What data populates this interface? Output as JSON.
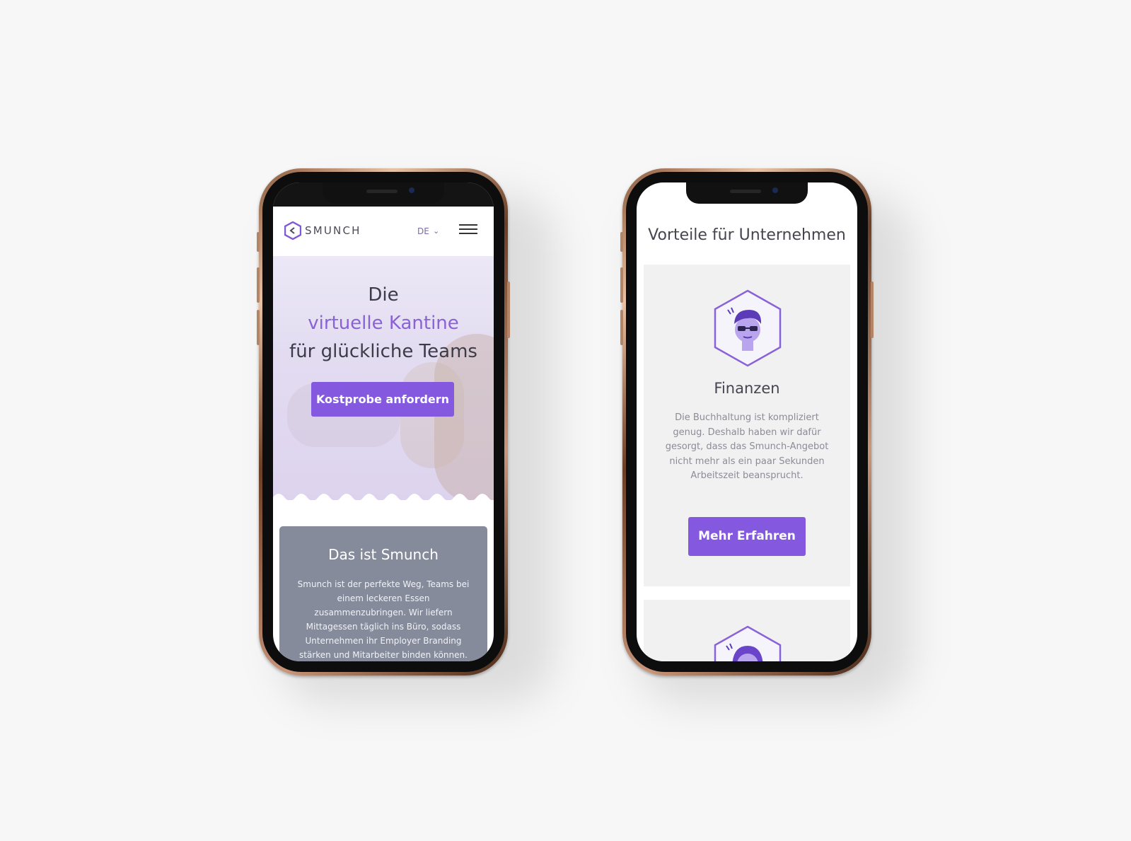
{
  "left_phone": {
    "nav": {
      "logo_text": "SMUNCH",
      "language": "DE",
      "language_chevron": "⌄",
      "menu_icon": "hamburger-icon"
    },
    "hero": {
      "line1": "Die",
      "line2": "virtuelle Kantine",
      "line3": "für glückliche Teams",
      "cta_label": "Kostprobe anfordern"
    },
    "about": {
      "title": "Das ist Smunch",
      "text": "Smunch ist der perfekte Weg, Teams bei einem leckeren Essen zusammenzubringen. Wir liefern Mittagessen täglich ins Büro, sodass Unternehmen ihr Employer Branding stärken und Mitarbeiter binden können."
    }
  },
  "right_phone": {
    "section_title": "Vorteile für Unternehmen",
    "feature": {
      "icon": "finance-person-icon",
      "title": "Finanzen",
      "text": "Die Buchhaltung ist kompliziert genug. Deshalb haben wir dafür gesorgt, dass das Smunch-Angebot nicht mehr als ein paar Sekunden Arbeitszeit beansprucht.",
      "button_label": "Mehr Erfahren"
    },
    "next_feature_icon": "woman-avatar-icon"
  },
  "colors": {
    "accent": "#8459e0",
    "accent_text": "#8a62d7",
    "gray_card": "#858b9b"
  }
}
